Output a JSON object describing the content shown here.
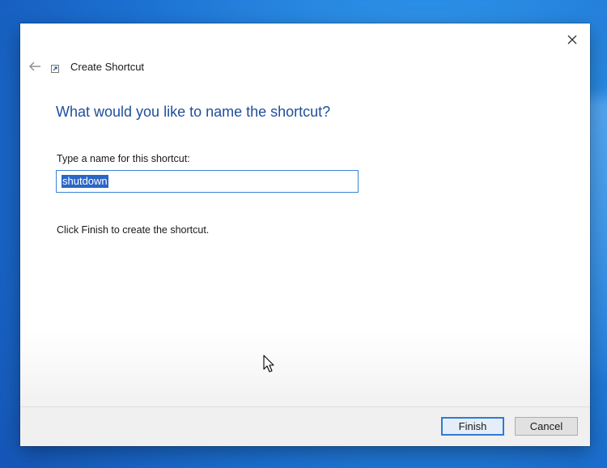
{
  "window": {
    "title": "Create Shortcut"
  },
  "wizard": {
    "heading": "What would you like to name the shortcut?",
    "name_label": "Type a name for this shortcut:",
    "name_value": "shutdown",
    "instruction": "Click Finish to create the shortcut."
  },
  "footer": {
    "finish_label": "Finish",
    "cancel_label": "Cancel"
  },
  "icons": {
    "back": "back-arrow-icon",
    "close": "close-icon",
    "wizard": "shortcut-icon",
    "cursor": "mouse-pointer-icon"
  },
  "colors": {
    "heading": "#1f4e9b",
    "selection": "#2a66c8",
    "input_border": "#3b86d6",
    "desktop": "#1b6fd0"
  }
}
